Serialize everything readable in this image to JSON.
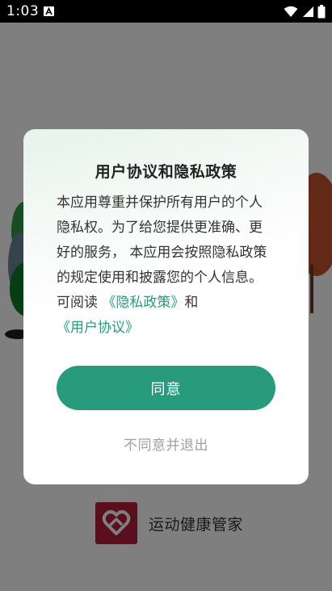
{
  "status_bar": {
    "time": "1:03",
    "app_notification_icon": "a-notification-icon",
    "wifi_icon": "wifi-icon",
    "signal_icon": "cellular-signal-icon",
    "battery_icon": "battery-icon"
  },
  "splash": {
    "app_name": "运动健康管家",
    "logo_icon": "heart-logo-icon",
    "logo_color": "#b51d3d"
  },
  "dialog": {
    "title": "用户协议和隐私政策",
    "body_text": "本应用尊重并保护所有用户的个人隐私权。为了给您提供更准确、更好的服务， 本应用会按照隐私政策的规定使用和披露您的个人信息。可阅读",
    "privacy_link": "《隐私政策》",
    "conjunction": "和",
    "user_agreement_link": "《用户协议》",
    "agree_label": "同意",
    "decline_label": "不同意并退出",
    "accent_color": "#279b7c"
  }
}
